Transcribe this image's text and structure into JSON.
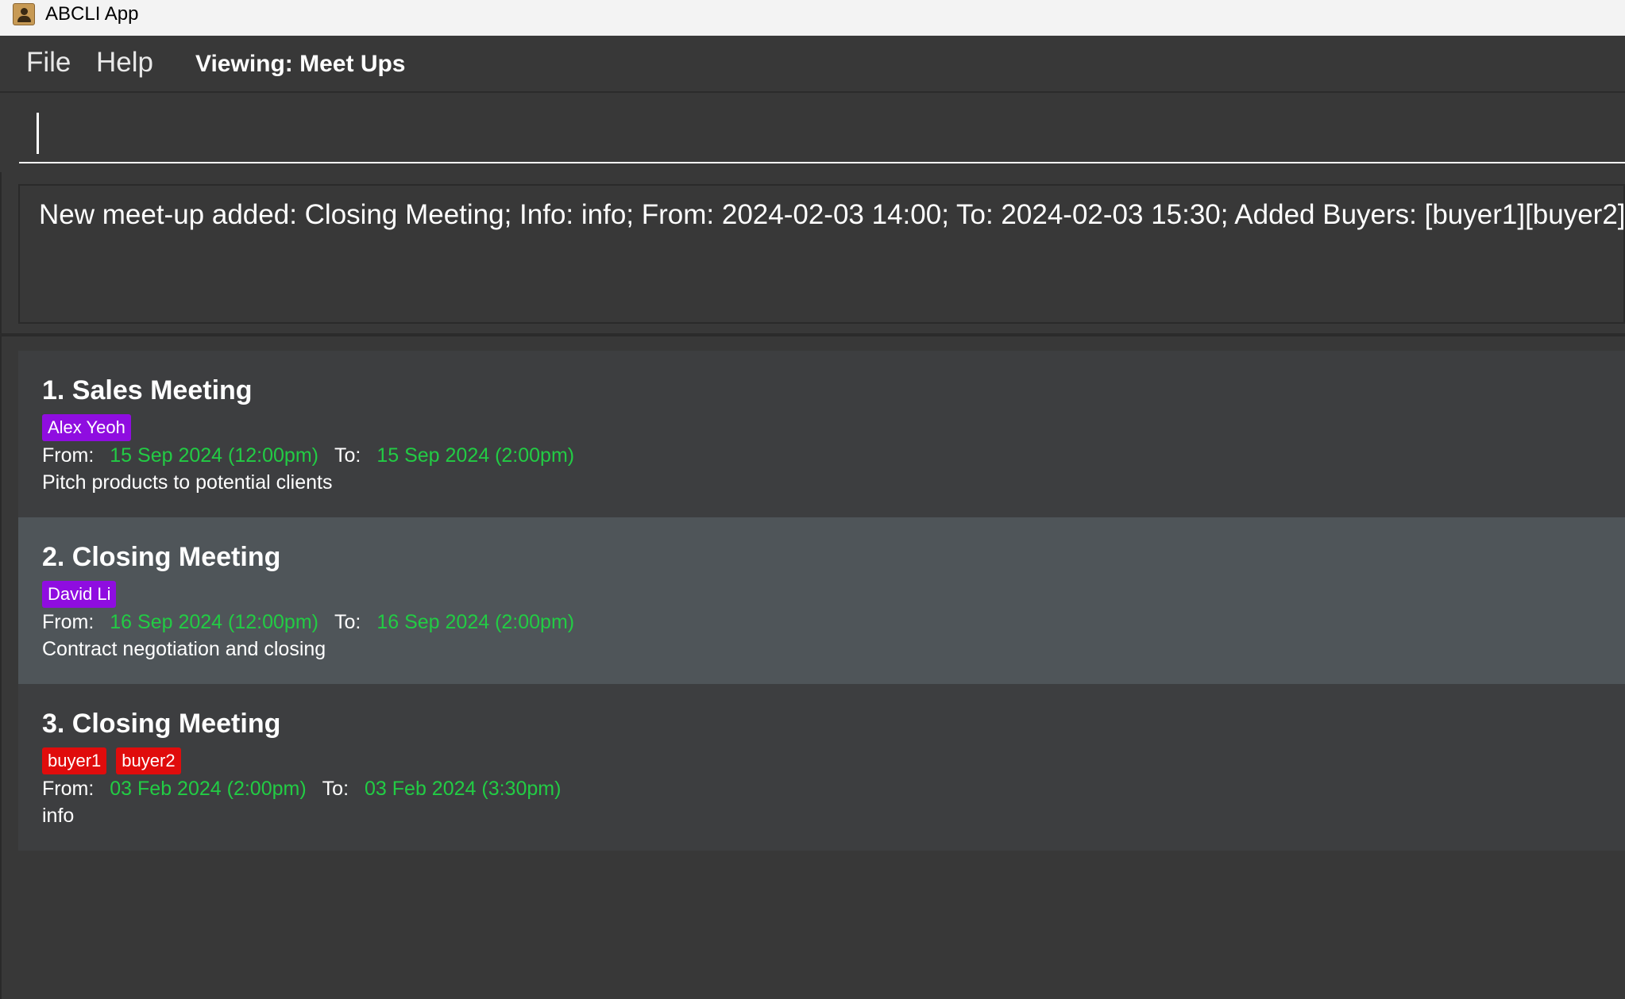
{
  "window": {
    "title": "ABCLI App",
    "app_icon": "contacts-book-icon"
  },
  "menu": {
    "file_label": "File",
    "help_label": "Help",
    "viewing_label": "Viewing: Meet Ups"
  },
  "command": {
    "value": "",
    "placeholder": ""
  },
  "result": {
    "message": "New meet-up added: Closing Meeting; Info: info; From: 2024-02-03 14:00; To: 2024-02-03 15:30; Added Buyers: [buyer1][buyer2]"
  },
  "labels": {
    "from": "From:",
    "to": "To:"
  },
  "colors": {
    "background": "#383838",
    "selected_card": "#4f5559",
    "card": "#3d3e40",
    "time_value": "#22cc44",
    "tag_purple": "#8f0de0",
    "tag_red": "#e00c0c"
  },
  "meetups": [
    {
      "title": "1. Sales Meeting",
      "tags": [
        {
          "text": "Alex Yeoh",
          "color": "purple"
        }
      ],
      "from": "15 Sep 2024 (12:00pm)",
      "to": "15 Sep 2024 (2:00pm)",
      "info": "Pitch products to potential clients",
      "selected": false
    },
    {
      "title": "2. Closing Meeting",
      "tags": [
        {
          "text": "David Li",
          "color": "purple"
        }
      ],
      "from": "16 Sep 2024 (12:00pm)",
      "to": "16 Sep 2024 (2:00pm)",
      "info": "Contract negotiation and closing",
      "selected": true
    },
    {
      "title": "3. Closing Meeting",
      "tags": [
        {
          "text": "buyer1",
          "color": "red"
        },
        {
          "text": "buyer2",
          "color": "red"
        }
      ],
      "from": "03 Feb 2024 (2:00pm)",
      "to": "03 Feb 2024 (3:30pm)",
      "info": "info",
      "selected": false
    }
  ]
}
